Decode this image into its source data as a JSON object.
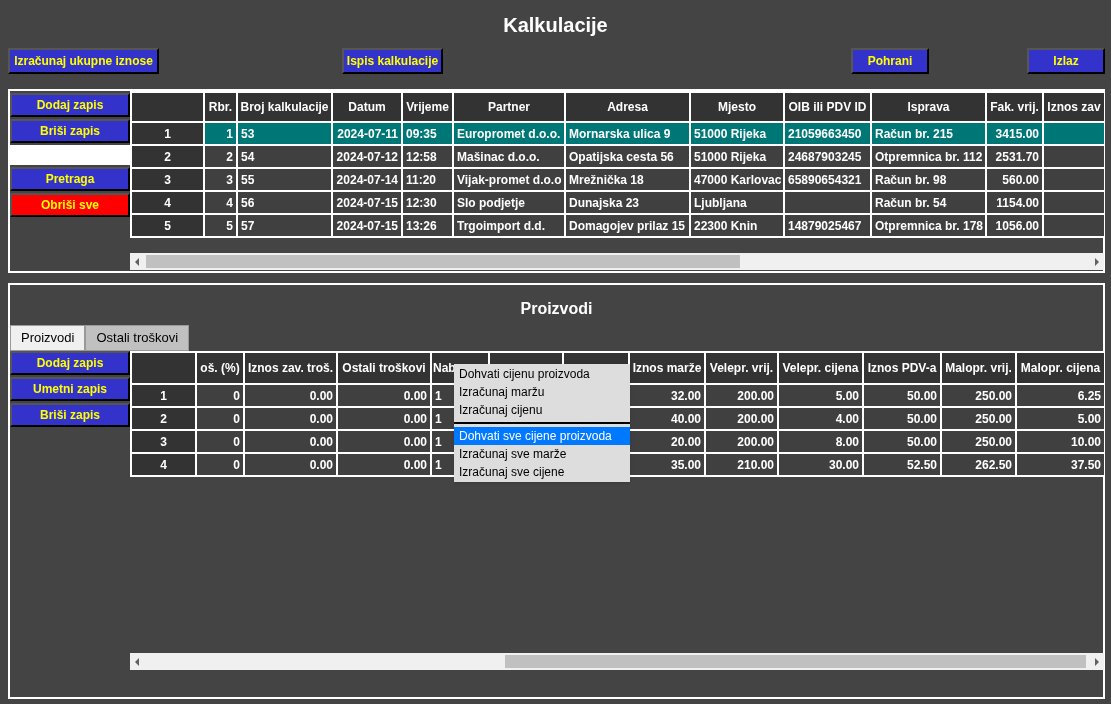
{
  "title": "Kalkulacije",
  "toolbar": [
    "Izračunaj ukupne iznose",
    "Ispis kalkulacije",
    "Pohrani",
    "Izlaz"
  ],
  "calc_panel": {
    "buttons": [
      {
        "label": "Dodaj zapis",
        "kind": "normal"
      },
      {
        "label": "Briši zapis",
        "kind": "normal"
      },
      {
        "label": "Pretraga",
        "kind": "normal",
        "search_field_before": true
      },
      {
        "label": "Obriši sve",
        "kind": "danger"
      }
    ],
    "table": {
      "columns": [
        "Rbr.",
        "Broj kalkulacije",
        "Datum",
        "Vrijeme",
        "Partner",
        "Adresa",
        "Mjesto",
        "OIB ili PDV ID",
        "Isprava",
        "Fak. vrij.",
        "Iznos zav"
      ],
      "rows": [
        {
          "header": "1",
          "selected": true,
          "cells": [
            "1",
            "53",
            "2024-07-11",
            "09:35",
            "Europromet d.o.o.",
            "Mornarska ulica 9",
            "51000 Rijeka",
            "21059663450",
            "Račun br. 215",
            "3415.00",
            ""
          ]
        },
        {
          "header": "2",
          "selected": false,
          "cells": [
            "2",
            "54",
            "2024-07-12",
            "12:58",
            "Mašinac d.o.o.",
            "Opatijska cesta 56",
            "51000 Rijeka",
            "24687903245",
            "Otpremnica br. 112",
            "2531.70",
            ""
          ]
        },
        {
          "header": "3",
          "selected": false,
          "cells": [
            "3",
            "55",
            "2024-07-14",
            "11:20",
            "Vijak-promet d.o.o",
            "Mrežnička 18",
            "47000 Karlovac",
            "65890654321",
            "Račun br. 98",
            "560.00",
            ""
          ]
        },
        {
          "header": "4",
          "selected": false,
          "cells": [
            "4",
            "56",
            "2024-07-15",
            "12:30",
            "Slo podjetje",
            "Dunajska 23",
            "Ljubljana",
            "",
            "Račun br. 54",
            "1154.00",
            ""
          ]
        },
        {
          "header": "5",
          "selected": false,
          "cells": [
            "5",
            "57",
            "2024-07-15",
            "13:26",
            "Trgoimport d.d.",
            "Domagojev prilaz 15",
            "22300 Knin",
            "14879025467",
            "Otpremnica br. 178",
            "1056.00",
            ""
          ]
        }
      ]
    }
  },
  "products_panel": {
    "title": "Proizvodi",
    "tabs": [
      {
        "label": "Proizvodi",
        "selected": true
      },
      {
        "label": "Ostali troškovi",
        "selected": false
      }
    ],
    "buttons": [
      "Dodaj zapis",
      "Umetni zapis",
      "Briši zapis"
    ],
    "table": {
      "columns": [
        "oš. (%)",
        "Iznos zav. troš.",
        "Ostali troškovi",
        "Nab",
        "",
        "",
        "Iznos marže",
        "Velepr. vrij.",
        "Velepr. cijena",
        "Iznos PDV-a",
        "Malopr. vrij.",
        "Malopr. cijena"
      ],
      "rows": [
        {
          "header": "1",
          "cells": [
            "0",
            "0.00",
            "0.00",
            "1",
            "",
            "",
            "32.00",
            "200.00",
            "5.00",
            "50.00",
            "250.00",
            "6.25"
          ]
        },
        {
          "header": "2",
          "cells": [
            "0",
            "0.00",
            "0.00",
            "1",
            "",
            "",
            "40.00",
            "200.00",
            "4.00",
            "50.00",
            "250.00",
            "5.00"
          ]
        },
        {
          "header": "3",
          "cells": [
            "0",
            "0.00",
            "0.00",
            "1",
            "",
            "",
            "20.00",
            "200.00",
            "8.00",
            "50.00",
            "250.00",
            "10.00"
          ]
        },
        {
          "header": "4",
          "cells": [
            "0",
            "0.00",
            "0.00",
            "1",
            "",
            "",
            "35.00",
            "210.00",
            "30.00",
            "52.50",
            "262.50",
            "37.50"
          ]
        }
      ]
    },
    "context_menu": [
      [
        {
          "label": "Dohvati cijenu proizvoda",
          "selected": false
        },
        {
          "label": "Izračunaj maržu",
          "selected": false
        },
        {
          "label": "Izračunaj cijenu",
          "selected": false
        }
      ],
      [
        {
          "label": "Dohvati sve cijene proizvoda",
          "selected": true
        },
        {
          "label": "Izračunaj sve marže",
          "selected": false
        },
        {
          "label": "Izračunaj sve cijene",
          "selected": false
        }
      ]
    ]
  }
}
